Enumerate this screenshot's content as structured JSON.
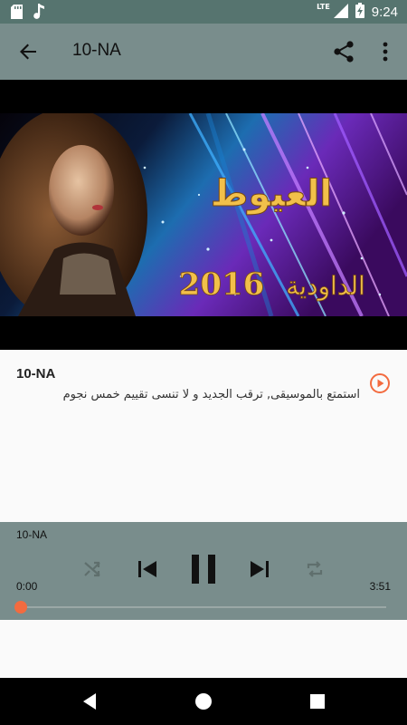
{
  "status_bar": {
    "time": "9:24",
    "network": "LTE",
    "icons": [
      "sd-card-icon",
      "music-note-icon",
      "signal-icon",
      "battery-charging-icon"
    ]
  },
  "toolbar": {
    "title": "10-NA",
    "icons": [
      "back-arrow-icon",
      "share-icon",
      "more-vert-icon"
    ]
  },
  "album_art": {
    "arabic_title": "العيوط",
    "arabic_subtitle": "الداودية",
    "year": "2016"
  },
  "track": {
    "title": "10-NA",
    "description": "استمتع بالموسيقى, ترقب الجديد و لا تنسى تقييم خمس نجوم"
  },
  "player": {
    "title": "10-NA",
    "current_time": "0:00",
    "total_time": "3:51",
    "progress": 0.0,
    "state": "playing",
    "accent_color": "#f36b3f",
    "controls": [
      "shuffle-icon",
      "skip-previous-icon",
      "pause-icon",
      "skip-next-icon",
      "repeat-icon"
    ]
  },
  "nav_bar": {
    "buttons": [
      "back-triangle-icon",
      "home-circle-icon",
      "recents-square-icon"
    ]
  },
  "colors": {
    "status_bar": "#56746f",
    "toolbar": "#798d8c",
    "accent": "#f36b3f"
  }
}
